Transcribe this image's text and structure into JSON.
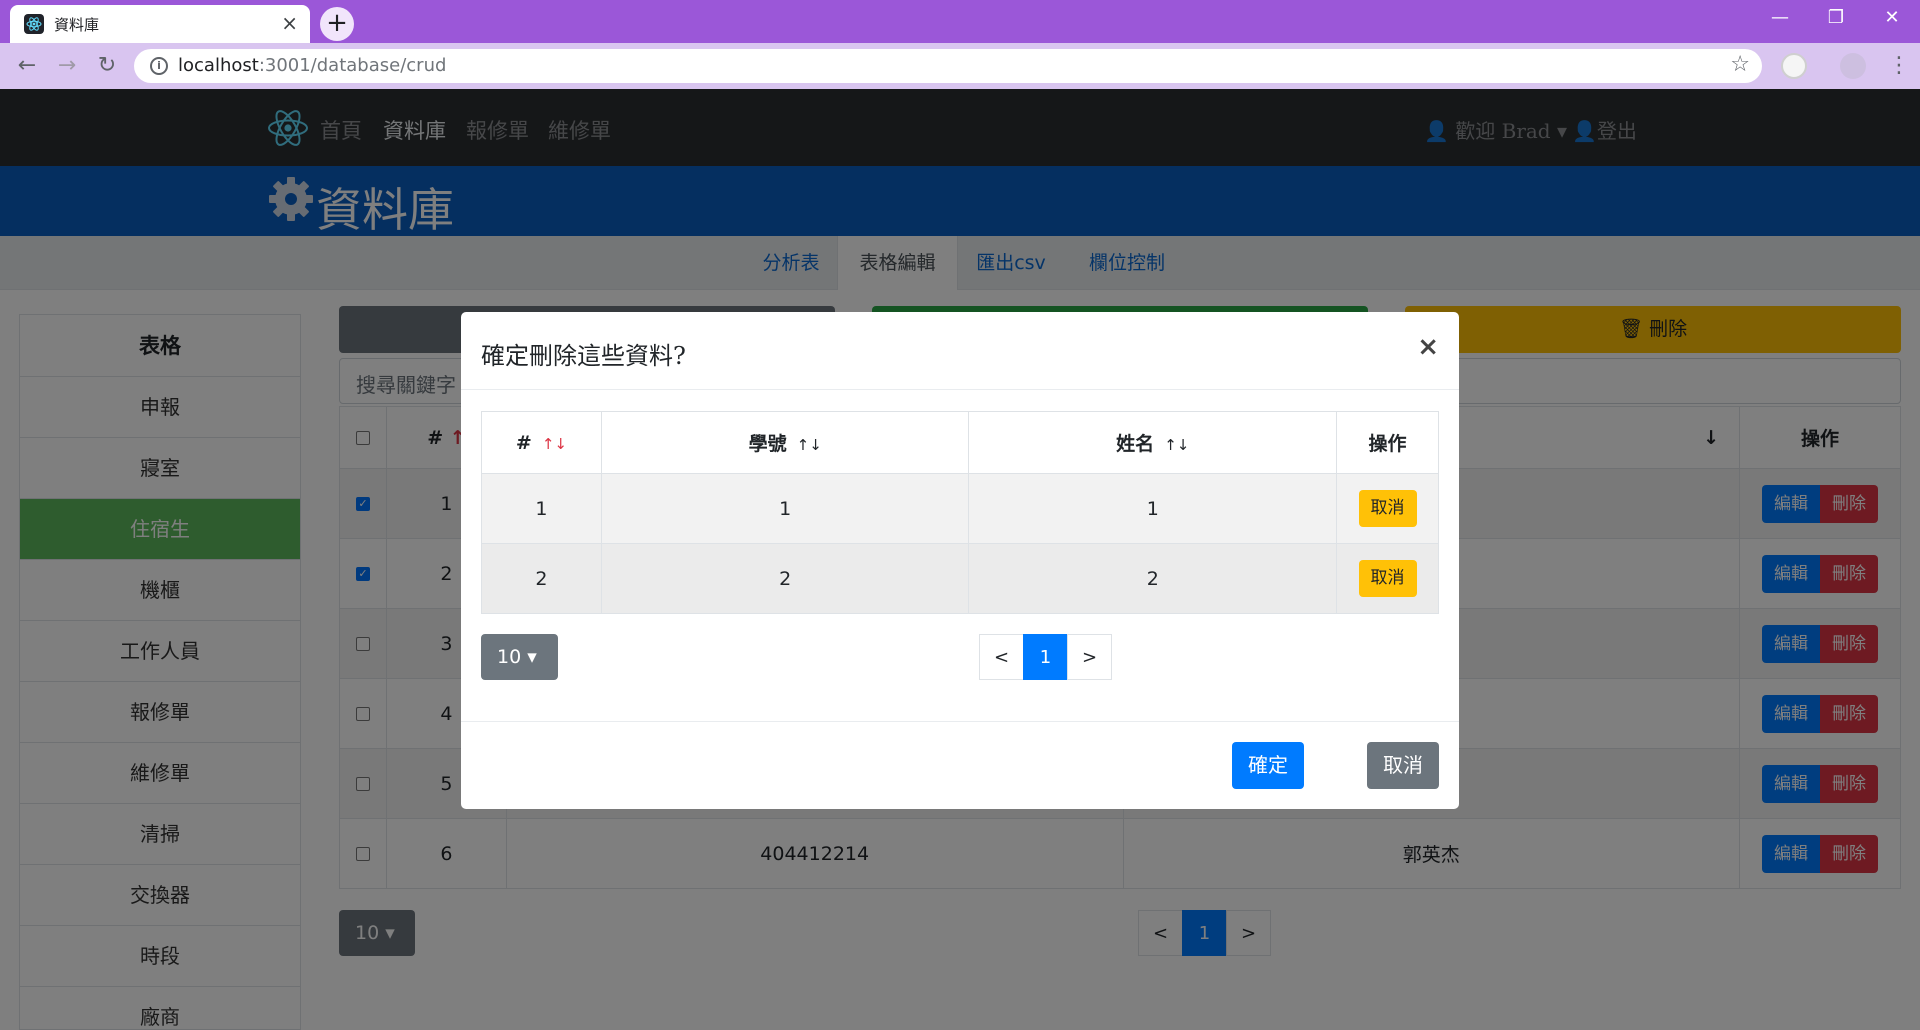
{
  "browser": {
    "tab_title": "資料庫",
    "url_host": "localhost",
    "url_path": ":3001/database/crud",
    "colors": {
      "tabbar": "#9b57d8",
      "toolbar": "#d9c5f0"
    }
  },
  "navbar": {
    "links": [
      "首頁",
      "資料庫",
      "報修單",
      "維修單"
    ],
    "welcome": "歡迎 Brad",
    "logout": "登出"
  },
  "banner": {
    "title": "資料庫"
  },
  "subnav": {
    "tabs": [
      "分析表",
      "表格編輯",
      "匯出csv",
      "欄位控制"
    ]
  },
  "sidebar": {
    "heading": "表格",
    "items": [
      "申報",
      "寢室",
      "住宿生",
      "機櫃",
      "工作人員",
      "報修單",
      "維修單",
      "清掃",
      "交換器",
      "時段",
      "廠商"
    ]
  },
  "actions": {
    "delete_label": "刪除"
  },
  "search": {
    "placeholder": "搜尋關鍵字"
  },
  "main_table": {
    "headers": [
      "#",
      "",
      "",
      "操作"
    ],
    "rows": [
      {
        "no": "1",
        "checked": true,
        "id": "",
        "name": ""
      },
      {
        "no": "2",
        "checked": true,
        "id": "",
        "name": ""
      },
      {
        "no": "3",
        "checked": false,
        "id": "",
        "name": ""
      },
      {
        "no": "4",
        "checked": false,
        "id": "",
        "name": ""
      },
      {
        "no": "5",
        "checked": false,
        "id": "",
        "name": ""
      },
      {
        "no": "6",
        "checked": false,
        "id": "404412214",
        "name": "郭英杰"
      }
    ],
    "edit_label": "編輯",
    "delete_label": "刪除",
    "page_size": "10",
    "page": "1"
  },
  "modal": {
    "title": "確定刪除這些資料?",
    "headers": [
      "#",
      "學號",
      "姓名",
      "操作"
    ],
    "rows": [
      {
        "no": "1",
        "id": "1",
        "name": "1"
      },
      {
        "no": "2",
        "id": "2",
        "name": "2"
      }
    ],
    "row_cancel_label": "取消",
    "page_size": "10",
    "prev": "<",
    "next": ">",
    "page": "1",
    "confirm_label": "確定",
    "cancel_label": "取消"
  }
}
